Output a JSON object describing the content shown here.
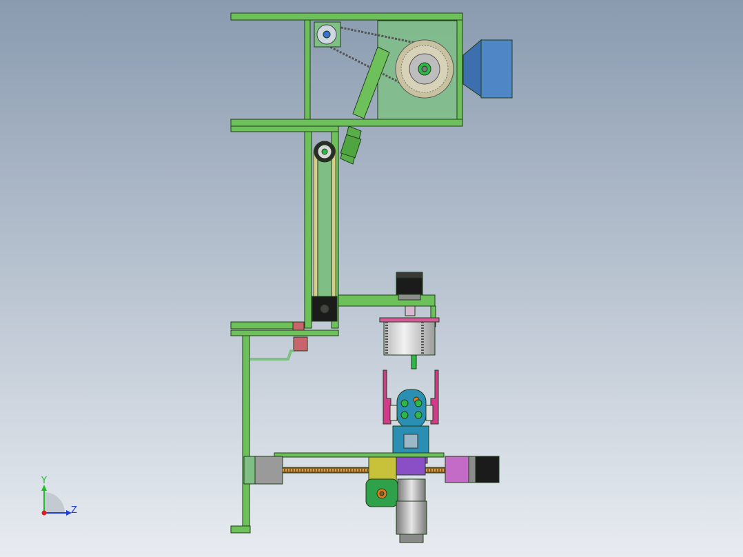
{
  "viewport": {
    "background_top": "#8a9bb0",
    "background_bottom": "#e8ecf1"
  },
  "colors": {
    "frame_green": "#6ec15a",
    "frame_green_dark": "#2f6b26",
    "panel_green": "#7fbf86",
    "hopper_blue": "#4f86c6",
    "motor_black": "#1b1b1b",
    "motor_gray": "#9a9a9a",
    "pink": "#d23b8c",
    "magenta": "#c46bc7",
    "purple": "#8a4fc7",
    "teal": "#2b8fb3",
    "yellow": "#c8c23a",
    "red_block": "#c9646c",
    "orange": "#e07a1f",
    "screw_brown": "#8a5a1f"
  },
  "triad": {
    "y_label": "Y",
    "z_label": "Z",
    "y_color": "#1fbf2a",
    "z_color": "#1f3fd8",
    "x_color": "#d81f1f"
  }
}
